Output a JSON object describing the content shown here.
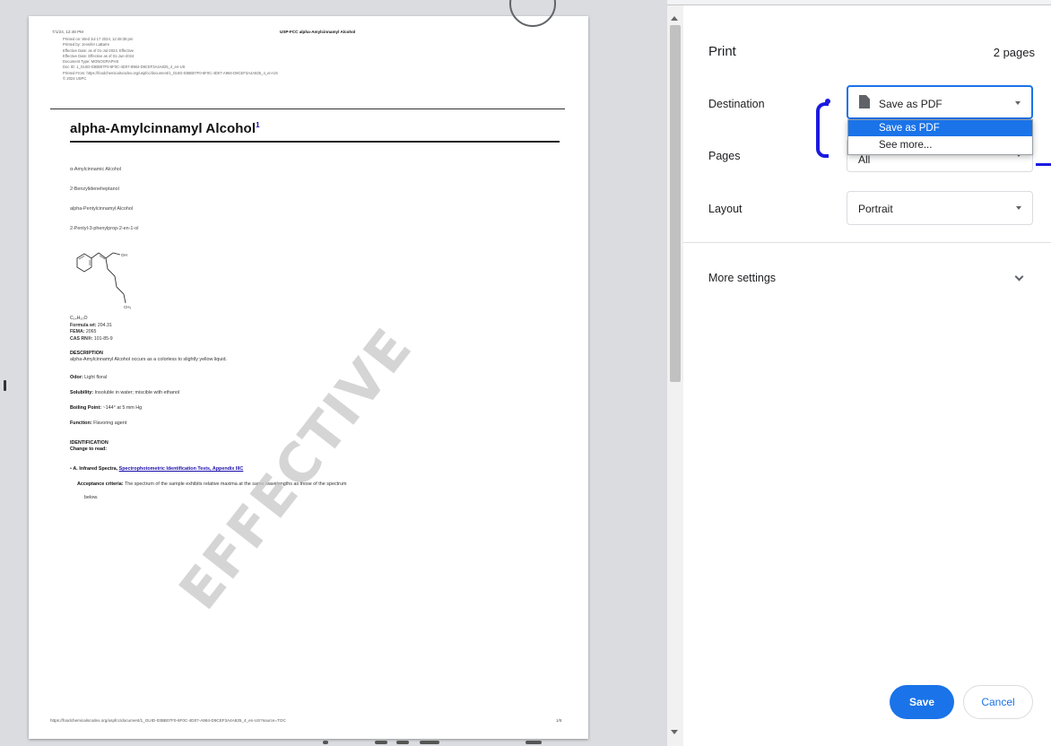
{
  "document": {
    "header_left": "7/1/24, 12:48 PM",
    "header_center": "USP-FCC alpha-Amylcinnamyl Alcohol",
    "meta_lines": [
      "Printed on: Wed Jul 17 2024, 12:48:38 pm",
      "Printed by: Jennifer LaBarre",
      "Effective Date: as of 01-Jul-2024: Effective",
      "Effective Date: Effective as of 01-Jun-2024",
      "Document Type: MONOGRAPHS",
      "Doc ID: 1_GUID-03BB07F0-6F0C-4D07-8984-D9CEF3A4A825_4_en-US",
      "Printed From: https://foodchemicalscodex.org/uspfcc/document/1_GUID-03BB07F0-6F0C-4D07-A984-D9CEF3A4A825_4_en-US",
      "© 2024 USPC"
    ],
    "title": "alpha-Amylcinnamyl Alcohol",
    "title_footnote": "1",
    "synonyms": [
      "α-Amylcinnamic Alcohol",
      "2-Benzylideneheptanol",
      "alpha-Pentylcinnamyl Alcohol",
      "2-Pentyl-3-phenylprop-2-en-1-ol"
    ],
    "structure_labels": {
      "oh": "OH",
      "ch3": "CH₃"
    },
    "formula": "C₁₄H₂₀O",
    "formula_wt_label": "Formula wt:",
    "formula_wt": "204.31",
    "fema_label": "FEMA:",
    "fema": "2065",
    "cas_label": "CAS RN®:",
    "cas": "101-85-9",
    "description_head": "DESCRIPTION",
    "description": "alpha-Amylcinnamyl Alcohol occurs as a colorless to slightly yellow liquid.",
    "odor_label": "Odor:",
    "odor": "Light floral",
    "solubility_label": "Solubility:",
    "solubility": "Insoluble in water; miscible with ethanol",
    "boiling_label": "Boiling Point:",
    "boiling": "~144° at 5 mm Hg",
    "function_label": "Function:",
    "function": "Flavoring agent",
    "identification_head": "IDENTIFICATION",
    "change_to_read": "Change to read:",
    "ident_a_label": "A. Infrared Spectra,",
    "ident_a_link": "Spectrophotometric Identification Tests, Appendix IIIC",
    "acceptance_label": "Acceptance criteria:",
    "acceptance_line1": "The spectrum of the sample exhibits relative maxima at the same wavelengths as those of the spectrum",
    "acceptance_line2": "below.",
    "watermark": "EFFECTIVE",
    "footer_url": "https://foodchemicalscodex.org/uspfcc/document/1_GUID-03BB07F0-6F0C-4D07-A984-D9CEF3A4A825_4_en-US?source=TOC",
    "footer_page": "1/8"
  },
  "print_panel": {
    "title": "Print",
    "page_count": "2 pages",
    "destination_label": "Destination",
    "destination_value": "Save as PDF",
    "destination_options": [
      "Save as PDF",
      "See more..."
    ],
    "pages_label": "Pages",
    "pages_value": "All",
    "layout_label": "Layout",
    "layout_value": "Portrait",
    "more_settings": "More settings",
    "save_label": "Save",
    "cancel_label": "Cancel"
  },
  "colors": {
    "accent": "#1a73e8",
    "annotation": "#1a1ae0",
    "link": "#1a0dab"
  },
  "icons": [
    "document-icon",
    "chevron-down-icon",
    "caret-down-icon",
    "scroll-up-arrow-icon",
    "scroll-down-arrow-icon"
  ]
}
